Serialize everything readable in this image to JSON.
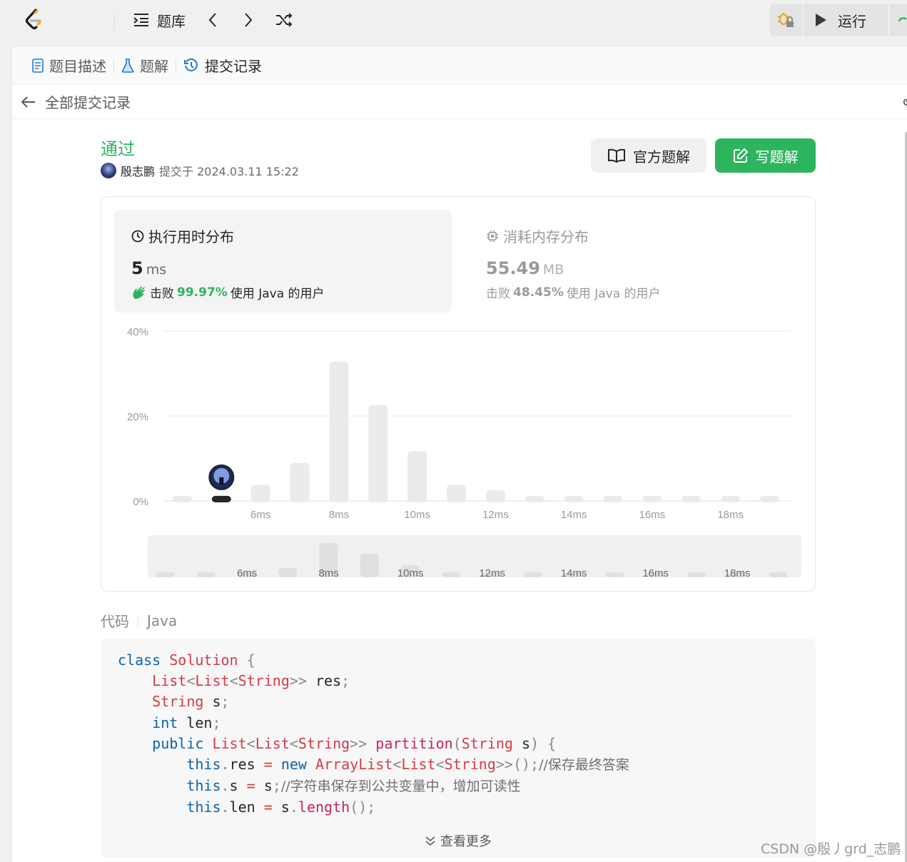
{
  "topbar": {
    "problem_bank_label": "题库",
    "run_label": "运行"
  },
  "tabs": [
    {
      "label": "题目描述"
    },
    {
      "label": "题解"
    },
    {
      "label": "提交记录"
    }
  ],
  "subbar": {
    "back_label": "全部提交记录"
  },
  "submission": {
    "status": "通过",
    "user": "殷志鹏",
    "submitted_text": "提交于 2024.03.11 15:22"
  },
  "actions": {
    "official_solution": "官方题解",
    "write_solution": "写题解"
  },
  "stats": {
    "time": {
      "title": "执行用时分布",
      "value": "5",
      "unit": "ms",
      "beat_prefix": "击败",
      "beat_pct": "99.97%",
      "beat_suffix": "使用 Java 的用户"
    },
    "memory": {
      "title": "消耗内存分布",
      "value": "55.49",
      "unit": "MB",
      "beat_prefix": "击败",
      "beat_pct": "48.45%",
      "beat_suffix": "使用 Java 的用户"
    }
  },
  "chart_data": {
    "type": "bar",
    "title": "",
    "xlabel": "",
    "ylabel": "",
    "ylim": [
      0,
      40
    ],
    "y_ticks": [
      "40%",
      "20%",
      "0%"
    ],
    "y_tick_values": [
      40,
      20,
      0
    ],
    "categories": [
      "4ms",
      "5ms",
      "6ms",
      "7ms",
      "8ms",
      "9ms",
      "10ms",
      "11ms",
      "12ms",
      "13ms",
      "14ms",
      "15ms",
      "16ms",
      "17ms",
      "18ms",
      "19ms"
    ],
    "x_tick_labels": [
      "6ms",
      "8ms",
      "10ms",
      "12ms",
      "14ms",
      "16ms",
      "18ms"
    ],
    "values": [
      1.2,
      1.2,
      3.8,
      8.9,
      32.8,
      22.6,
      11.7,
      3.8,
      2.5,
      1.2,
      1.2,
      1.2,
      1.2,
      1.2,
      1.2,
      1.2
    ],
    "highlight_category": "5ms",
    "grid": true,
    "legend": "none"
  },
  "navigator": {
    "x_tick_labels": [
      "6ms",
      "8ms",
      "10ms",
      "12ms",
      "14ms",
      "16ms",
      "18ms"
    ]
  },
  "code": {
    "header_label": "代码",
    "language": "Java",
    "show_more": "查看更多"
  },
  "watermark": "CSDN @殷丿grd_志鹏",
  "colors": {
    "accent_green": "#2db55d",
    "bar_gray": "#ebebeb",
    "tab_active_icon": "#1a7cd8"
  }
}
